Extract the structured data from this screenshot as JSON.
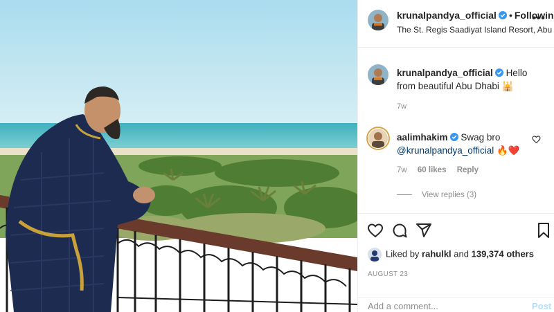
{
  "post": {
    "username": "krunalpandya_official",
    "following_label": "Following",
    "dot": "•",
    "location": "The St. Regis Saadiyat Island Resort, Abu Dhabi",
    "more_label": "•••"
  },
  "caption": {
    "username": "krunalpandya_official",
    "text": "Hello from beautiful Abu Dhabi 🕌",
    "time": "7w"
  },
  "comment": {
    "username": "aalimhakim",
    "text_start": "Swag bro",
    "mention": "@krunalpandya_official",
    "emojis": "🔥❤️",
    "time": "7w",
    "likes": "60 likes",
    "reply_label": "Reply",
    "view_replies": "View replies (3)"
  },
  "likes": {
    "prefix": "Liked by",
    "liker": "rahulkl",
    "and": "and",
    "others": "139,374 others"
  },
  "date": "AUGUST 23",
  "add_comment": {
    "placeholder": "Add a comment...",
    "post_label": "Post"
  },
  "colors": {
    "verified": "#3897f0",
    "link": "#00376b",
    "post_disabled": "#b2dffc",
    "muted": "#8e8e8e",
    "heart": "#e0245e"
  },
  "icons": [
    "verified-badge-icon",
    "more-options-icon",
    "like-heart-icon",
    "comment-bubble-icon",
    "share-plane-icon",
    "save-bookmark-icon",
    "comment-like-heart-icon"
  ]
}
